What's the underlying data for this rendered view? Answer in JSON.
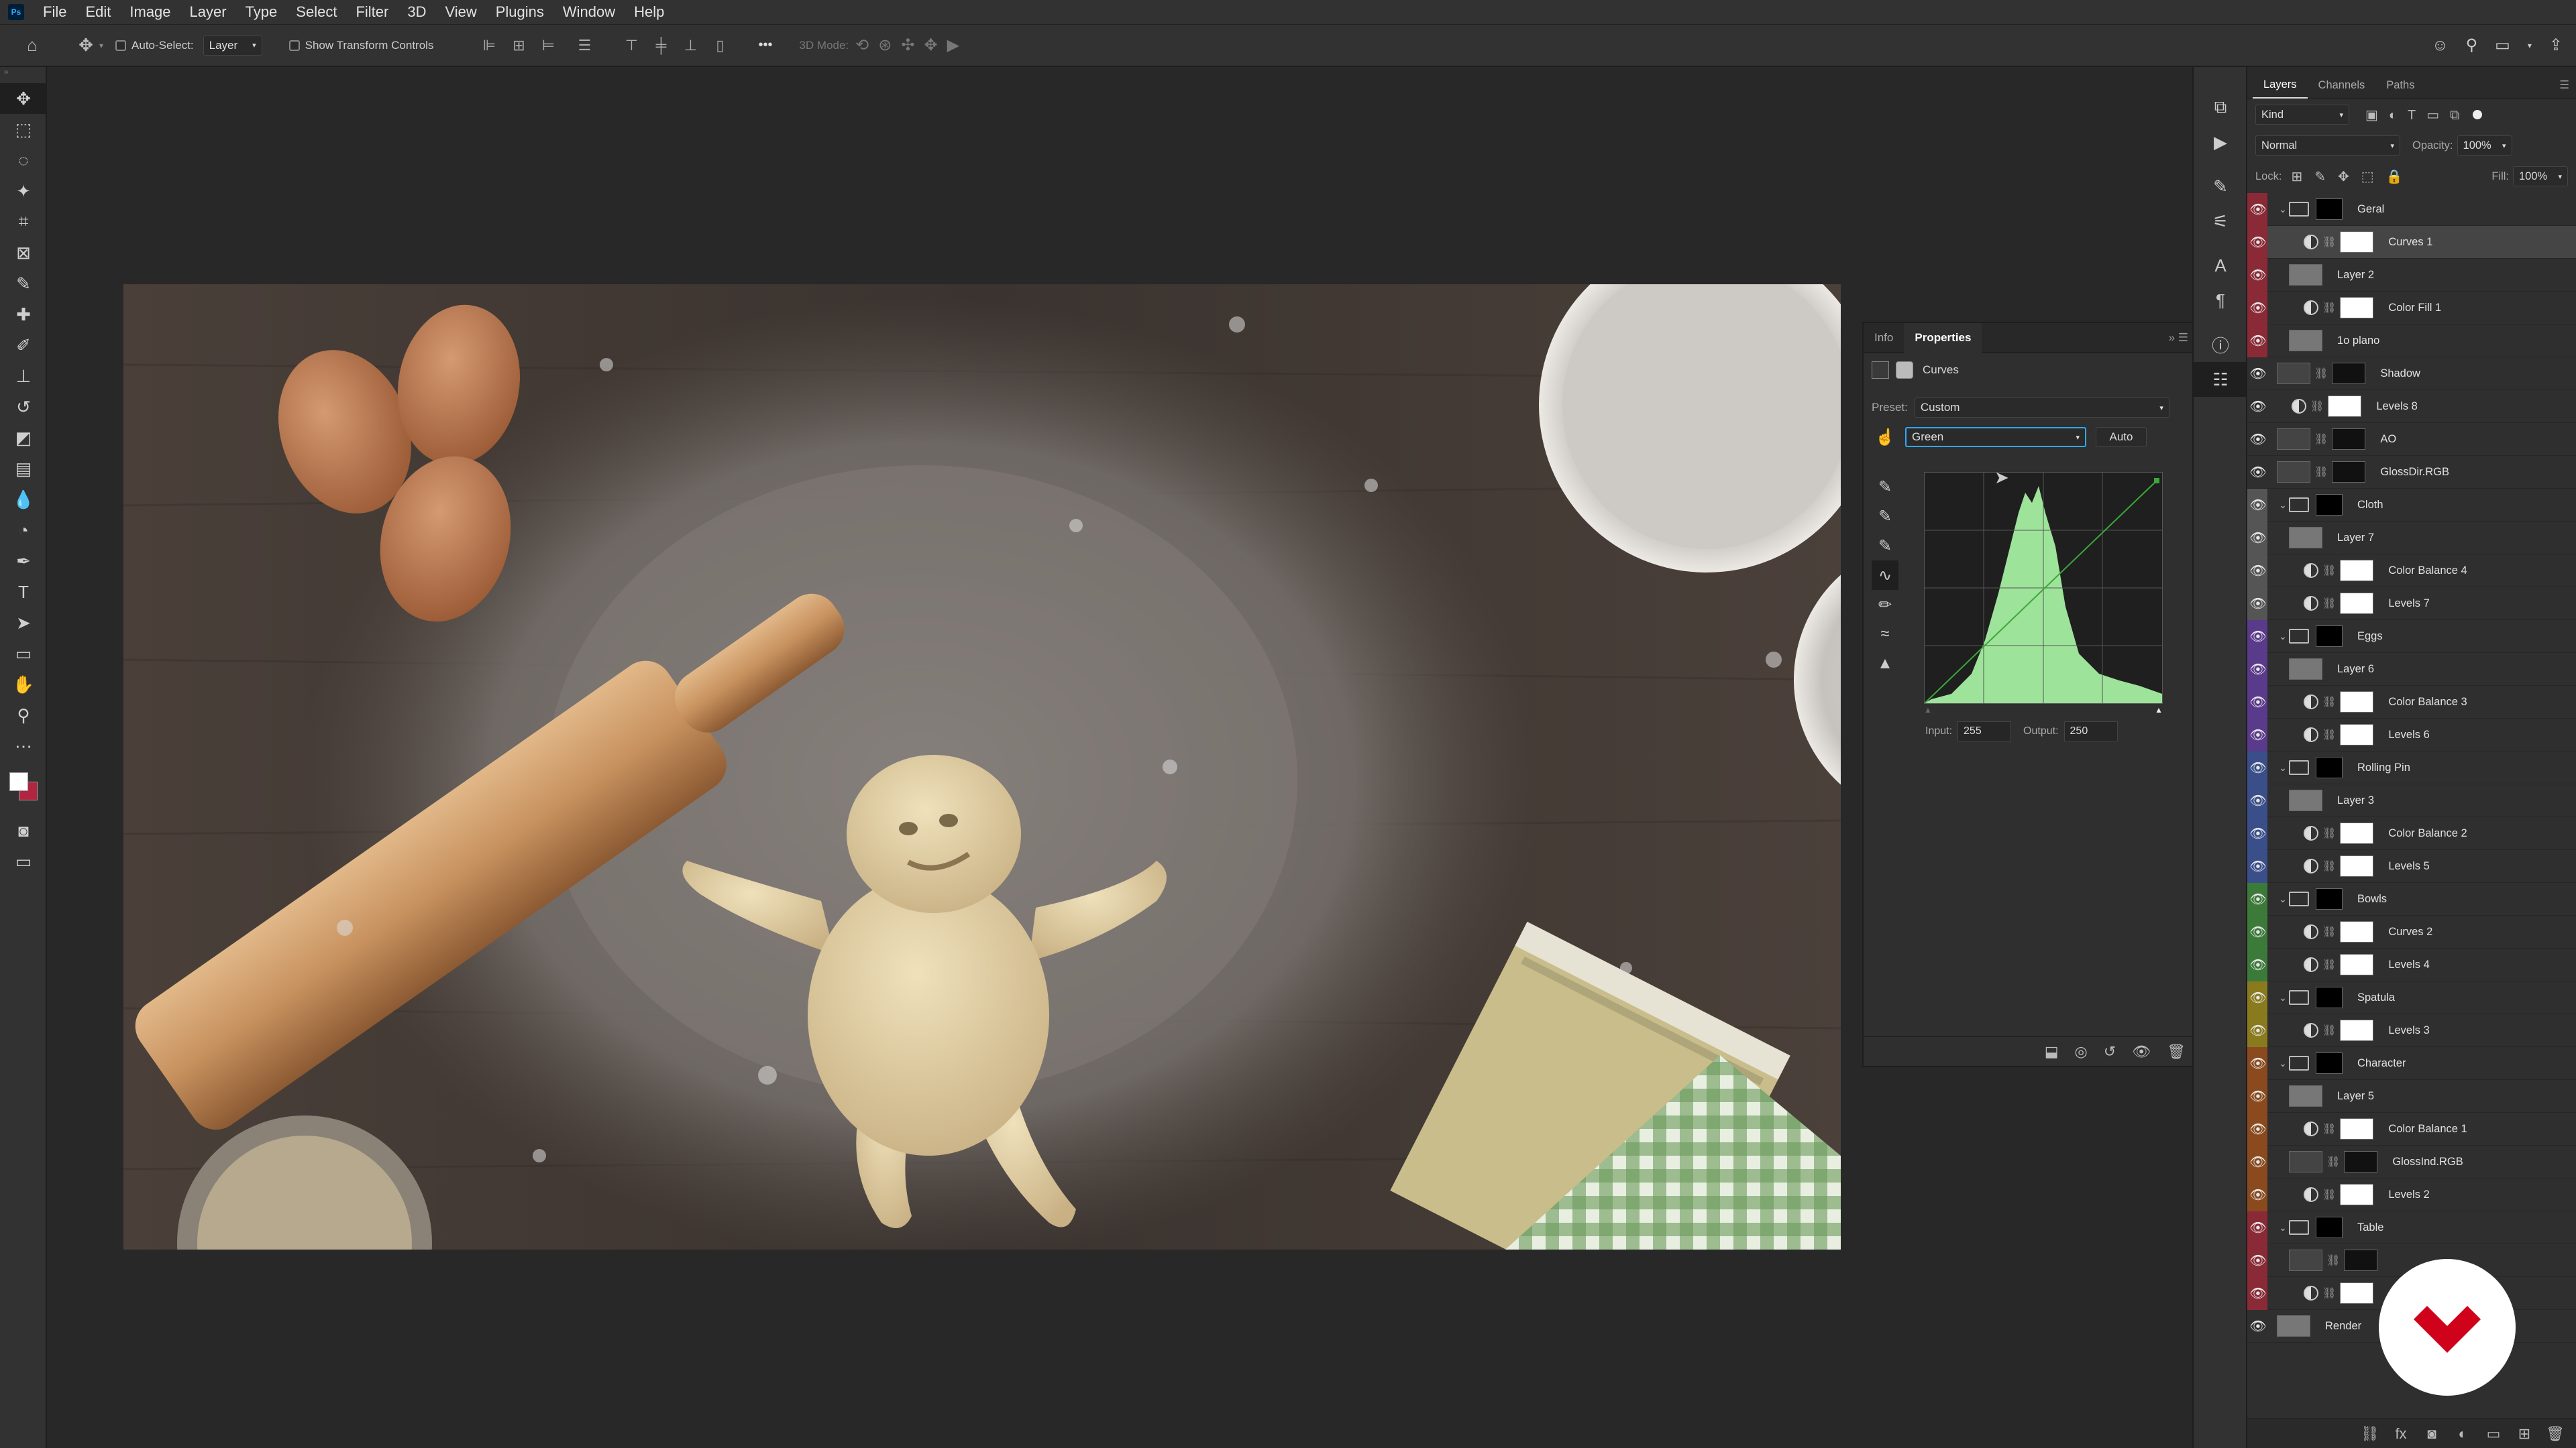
{
  "menu": [
    "File",
    "Edit",
    "Image",
    "Layer",
    "Type",
    "Select",
    "Filter",
    "3D",
    "View",
    "Plugins",
    "Window",
    "Help"
  ],
  "app_logo": "Ps",
  "options": {
    "auto_select": "Auto-Select:",
    "target": "Layer",
    "show_transform": "Show Transform Controls",
    "mode_3d": "3D Mode:",
    "more": "•••"
  },
  "tools": [
    "move-tool",
    "marquee-tool",
    "lasso-tool",
    "magic-wand-tool",
    "crop-tool",
    "frame-tool",
    "eyedropper-tool",
    "healing-tool",
    "brush-tool",
    "stamp-tool",
    "history-brush-tool",
    "eraser-tool",
    "gradient-tool",
    "blur-tool",
    "dodge-tool",
    "pen-tool",
    "type-tool",
    "path-select-tool",
    "rectangle-tool",
    "hand-tool",
    "zoom-tool",
    "more-tools"
  ],
  "properties": {
    "tabs": [
      "Info",
      "Properties"
    ],
    "active_tab": "Properties",
    "adjustment": "Curves",
    "preset_label": "Preset:",
    "preset_value": "Custom",
    "channel": "Green",
    "auto": "Auto",
    "input_label": "Input:",
    "input_value": "255",
    "output_label": "Output:",
    "output_value": "250"
  },
  "layers_panel": {
    "tabs": [
      "Layers",
      "Channels",
      "Paths"
    ],
    "kind": "Kind",
    "blend_mode": "Normal",
    "opacity_label": "Opacity:",
    "opacity": "100%",
    "lock_label": "Lock:",
    "fill_label": "Fill:",
    "fill": "100%",
    "layers": [
      {
        "name": "Geral",
        "type": "group",
        "color": "#8a2a36",
        "selected": false,
        "indent": 0
      },
      {
        "name": "Curves 1",
        "type": "adjust",
        "color": "#8a2a36",
        "selected": true,
        "indent": 1
      },
      {
        "name": "Layer 2",
        "type": "pixel",
        "color": "#8a2a36",
        "selected": false,
        "indent": 1
      },
      {
        "name": "Color Fill 1",
        "type": "fill",
        "color": "#8a2a36",
        "selected": false,
        "indent": 1
      },
      {
        "name": "1o plano",
        "type": "pixel",
        "color": "#8a2a36",
        "selected": false,
        "indent": 1
      },
      {
        "name": "Shadow",
        "type": "masked",
        "color": "",
        "selected": false,
        "indent": 0
      },
      {
        "name": "Levels 8",
        "type": "adjust",
        "color": "",
        "selected": false,
        "indent": 0
      },
      {
        "name": "AO",
        "type": "masked",
        "color": "",
        "selected": false,
        "indent": 0
      },
      {
        "name": "GlossDir.RGB",
        "type": "masked",
        "color": "",
        "selected": false,
        "indent": 0
      },
      {
        "name": "Cloth",
        "type": "group",
        "color": "#555",
        "selected": false,
        "indent": 0
      },
      {
        "name": "Layer 7",
        "type": "pixel",
        "color": "#555",
        "selected": false,
        "indent": 1
      },
      {
        "name": "Color Balance 4",
        "type": "adjust",
        "color": "#555",
        "selected": false,
        "indent": 1
      },
      {
        "name": "Levels 7",
        "type": "adjust",
        "color": "#555",
        "selected": false,
        "indent": 1
      },
      {
        "name": "Eggs",
        "type": "group",
        "color": "#5a3a8a",
        "selected": false,
        "indent": 0
      },
      {
        "name": "Layer 6",
        "type": "pixel",
        "color": "#5a3a8a",
        "selected": false,
        "indent": 1
      },
      {
        "name": "Color Balance 3",
        "type": "adjust",
        "color": "#5a3a8a",
        "selected": false,
        "indent": 1
      },
      {
        "name": "Levels 6",
        "type": "adjust",
        "color": "#5a3a8a",
        "selected": false,
        "indent": 1
      },
      {
        "name": "Rolling Pin",
        "type": "group",
        "color": "#3a4f8a",
        "selected": false,
        "indent": 0
      },
      {
        "name": "Layer 3",
        "type": "pixel",
        "color": "#3a4f8a",
        "selected": false,
        "indent": 1
      },
      {
        "name": "Color Balance 2",
        "type": "adjust",
        "color": "#3a4f8a",
        "selected": false,
        "indent": 1
      },
      {
        "name": "Levels 5",
        "type": "adjust",
        "color": "#3a4f8a",
        "selected": false,
        "indent": 1
      },
      {
        "name": "Bowls",
        "type": "group",
        "color": "#3c7a3a",
        "selected": false,
        "indent": 0
      },
      {
        "name": "Curves 2",
        "type": "adjust",
        "color": "#3c7a3a",
        "selected": false,
        "indent": 1
      },
      {
        "name": "Levels 4",
        "type": "adjust",
        "color": "#3c7a3a",
        "selected": false,
        "indent": 1
      },
      {
        "name": "Spatula",
        "type": "group",
        "color": "#8a7a1e",
        "selected": false,
        "indent": 0
      },
      {
        "name": "Levels 3",
        "type": "adjust",
        "color": "#8a7a1e",
        "selected": false,
        "indent": 1
      },
      {
        "name": "Character",
        "type": "group",
        "color": "#8a4a1e",
        "selected": false,
        "indent": 0
      },
      {
        "name": "Layer 5",
        "type": "pixel",
        "color": "#8a4a1e",
        "selected": false,
        "indent": 1
      },
      {
        "name": "Color Balance 1",
        "type": "adjust",
        "color": "#8a4a1e",
        "selected": false,
        "indent": 1
      },
      {
        "name": "GlossInd.RGB",
        "type": "masked",
        "color": "#8a4a1e",
        "selected": false,
        "indent": 1
      },
      {
        "name": "Levels 2",
        "type": "adjust",
        "color": "#8a4a1e",
        "selected": false,
        "indent": 1
      },
      {
        "name": "Table",
        "type": "group",
        "color": "#8a2a36",
        "selected": false,
        "indent": 0
      },
      {
        "name": "",
        "type": "masked",
        "color": "#8a2a36",
        "selected": false,
        "indent": 1
      },
      {
        "name": "",
        "type": "adjust",
        "color": "#8a2a36",
        "selected": false,
        "indent": 1
      },
      {
        "name": "Render",
        "type": "pixel",
        "color": "",
        "selected": false,
        "indent": 0
      }
    ]
  },
  "colors": {
    "accent": "#31a8ff",
    "curve_green": "#9ee39a",
    "badge_red": "#d0021b"
  }
}
